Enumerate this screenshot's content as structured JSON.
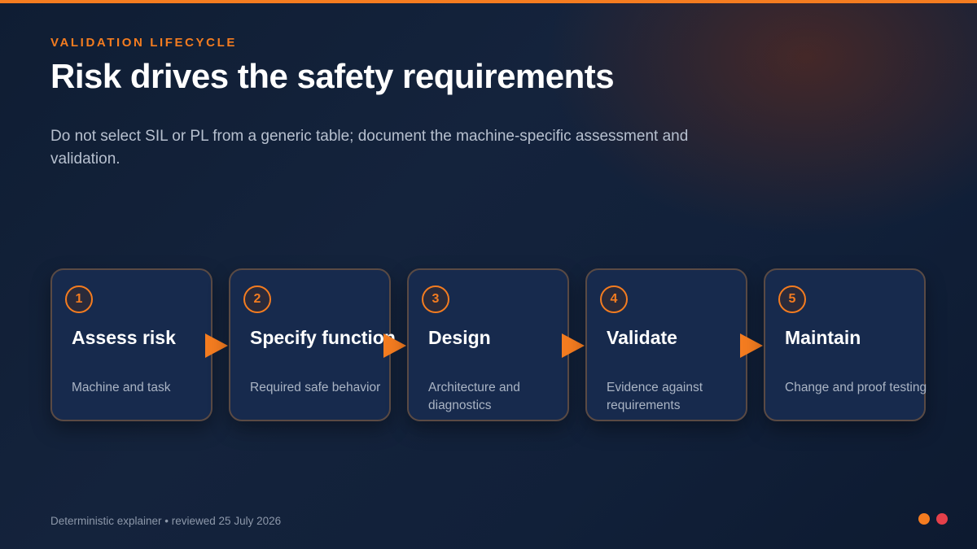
{
  "header": {
    "eyebrow": "VALIDATION LIFECYCLE",
    "title": "Risk drives the safety requirements",
    "subtitle": "Do not select SIL or PL from a generic table; document the machine-specific assessment and validation."
  },
  "steps": [
    {
      "number": "1",
      "title": "Assess risk",
      "description": "Machine and task"
    },
    {
      "number": "2",
      "title": "Specify function",
      "description": "Required safe behavior"
    },
    {
      "number": "3",
      "title": "Design",
      "description": "Architecture and diagnostics"
    },
    {
      "number": "4",
      "title": "Validate",
      "description": "Evidence against requirements"
    },
    {
      "number": "5",
      "title": "Maintain",
      "description": "Change and proof testing"
    }
  ],
  "footer": {
    "text": "Deterministic explainer • reviewed 25 July 2026"
  },
  "colors": {
    "accent": "#f47c20",
    "secondary_accent": "#e5404a",
    "background": "#13233d",
    "card": "#172a4d"
  }
}
